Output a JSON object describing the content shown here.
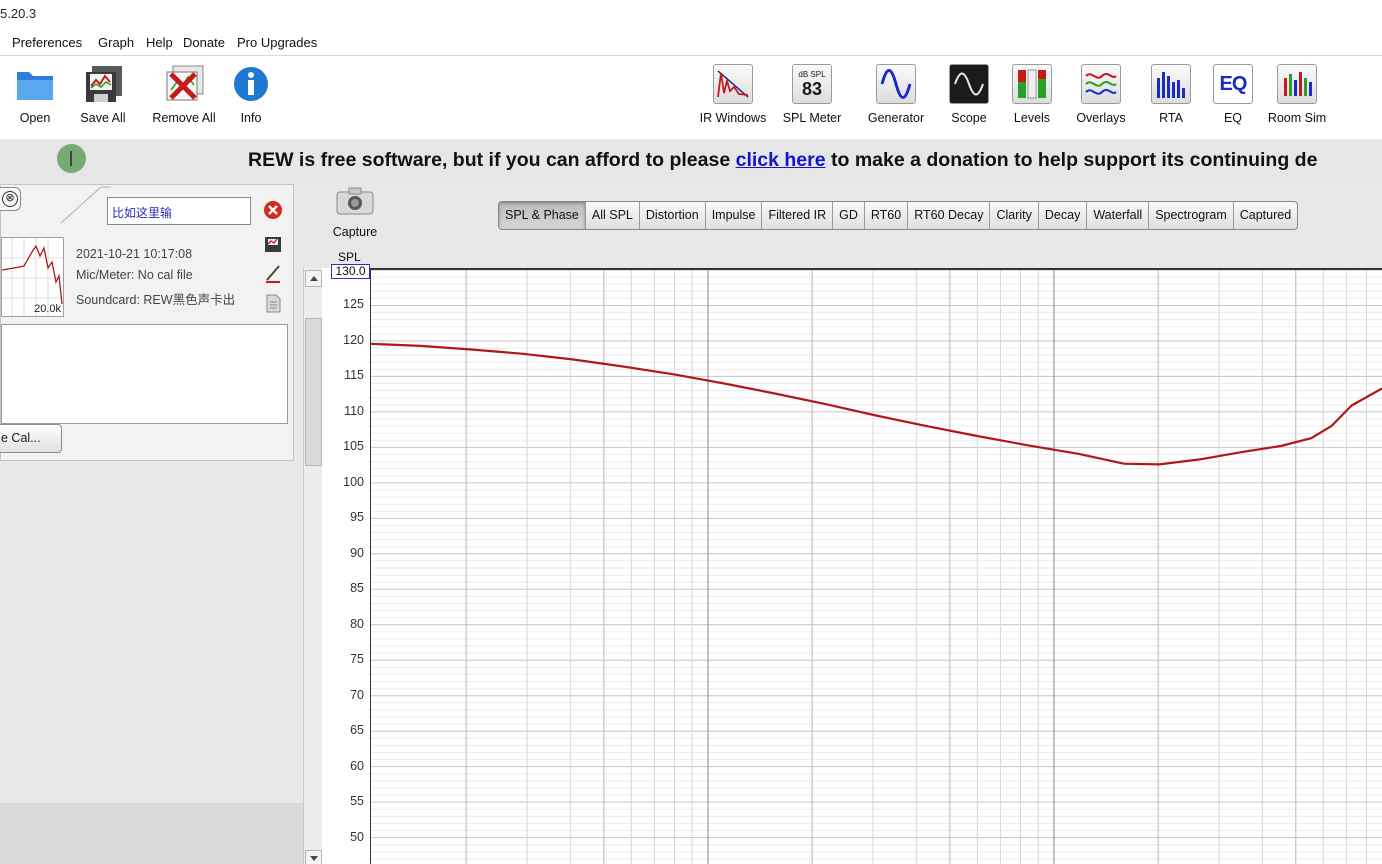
{
  "window": {
    "title": "5.20.3"
  },
  "menu": {
    "items": [
      "Preferences",
      "Graph",
      "Help",
      "Donate",
      "Pro Upgrades"
    ]
  },
  "toolbar": {
    "left": [
      {
        "label": "Open",
        "icon": "folder-icon"
      },
      {
        "label": "Save All",
        "icon": "save-all-icon"
      },
      {
        "label": "Remove All",
        "icon": "remove-all-icon"
      },
      {
        "label": "Info",
        "icon": "info-icon"
      }
    ],
    "right": [
      {
        "label": "IR Windows",
        "icon": "ir-windows-icon"
      },
      {
        "label": "SPL Meter",
        "icon": "spl-meter-icon",
        "badge_top": "dB SPL",
        "badge_value": "83"
      },
      {
        "label": "Generator",
        "icon": "generator-icon"
      },
      {
        "label": "Scope",
        "icon": "scope-icon"
      },
      {
        "label": "Levels",
        "icon": "levels-icon"
      },
      {
        "label": "Overlays",
        "icon": "overlays-icon"
      },
      {
        "label": "RTA",
        "icon": "rta-icon"
      },
      {
        "label": "EQ",
        "icon": "eq-icon",
        "badge_value": "EQ"
      },
      {
        "label": "Room Sim",
        "icon": "room-sim-icon"
      }
    ]
  },
  "donation": {
    "before": "REW is free software, but if you can afford to please ",
    "link": "click here",
    "after": " to make a donation to help support its continuing de"
  },
  "measurement": {
    "name": "比如这里输",
    "thumb_label": "20.0k",
    "date": "2021-10-21 10:17:08",
    "mic": "Mic/Meter: No cal file",
    "soundcard": "Soundcard: REW黑色声卡出",
    "cal_button": "e Cal..."
  },
  "capture_label": "Capture",
  "tabs": [
    "SPL & Phase",
    "All SPL",
    "Distortion",
    "Impulse",
    "Filtered IR",
    "GD",
    "RT60",
    "RT60 Decay",
    "Clarity",
    "Decay",
    "Waterfall",
    "Spectrogram",
    "Captured"
  ],
  "active_tab": "SPL & Phase",
  "graph": {
    "y_axis_title": "SPL",
    "y_max_label": "130.0",
    "y_ticks": [
      "125",
      "120",
      "115",
      "110",
      "105",
      "100",
      "95",
      "90",
      "85",
      "80",
      "75",
      "70",
      "65",
      "60",
      "55",
      "50"
    ],
    "trace_color": "#b01818"
  },
  "chart_data": {
    "type": "line",
    "ylabel": "SPL",
    "ylim": [
      46,
      130
    ],
    "y_axis": "linear",
    "grid": true,
    "series": [
      {
        "values": [
          [
            0.0,
            119.6
          ],
          [
            0.05,
            119.3
          ],
          [
            0.1,
            118.8
          ],
          [
            0.15,
            118.2
          ],
          [
            0.2,
            117.4
          ],
          [
            0.25,
            116.4
          ],
          [
            0.3,
            115.3
          ],
          [
            0.35,
            114.0
          ],
          [
            0.4,
            112.6
          ],
          [
            0.45,
            111.1
          ],
          [
            0.5,
            109.5
          ],
          [
            0.55,
            108.0
          ],
          [
            0.6,
            106.6
          ],
          [
            0.65,
            105.3
          ],
          [
            0.7,
            104.1
          ],
          [
            0.745,
            102.7
          ],
          [
            0.78,
            102.6
          ],
          [
            0.82,
            103.3
          ],
          [
            0.86,
            104.3
          ],
          [
            0.9,
            105.2
          ],
          [
            0.93,
            106.3
          ],
          [
            0.95,
            108.0
          ],
          [
            0.97,
            110.9
          ],
          [
            1.0,
            113.3
          ]
        ]
      }
    ]
  }
}
